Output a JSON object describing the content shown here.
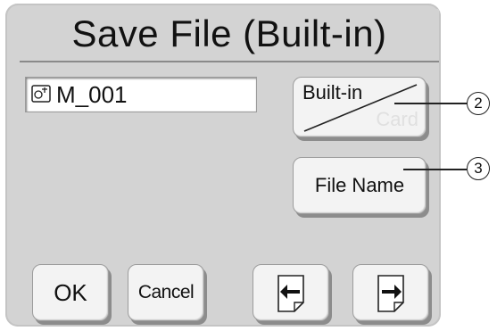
{
  "dialog": {
    "title": "Save File (Built-in)"
  },
  "file": {
    "name": "M_001",
    "icon": "sewing-file-icon"
  },
  "buttons": {
    "media_top": "Built-in",
    "media_bottom": "Card",
    "file_name": "File Name",
    "ok": "OK",
    "cancel": "Cancel",
    "prev_icon": "page-previous-icon",
    "next_icon": "page-next-icon"
  },
  "callouts": {
    "media": "2",
    "file_name": "3"
  },
  "colors": {
    "panel": "#d3d3d3",
    "button_face": "#f3f3f3",
    "inactive_text": "#e0e0e0"
  }
}
